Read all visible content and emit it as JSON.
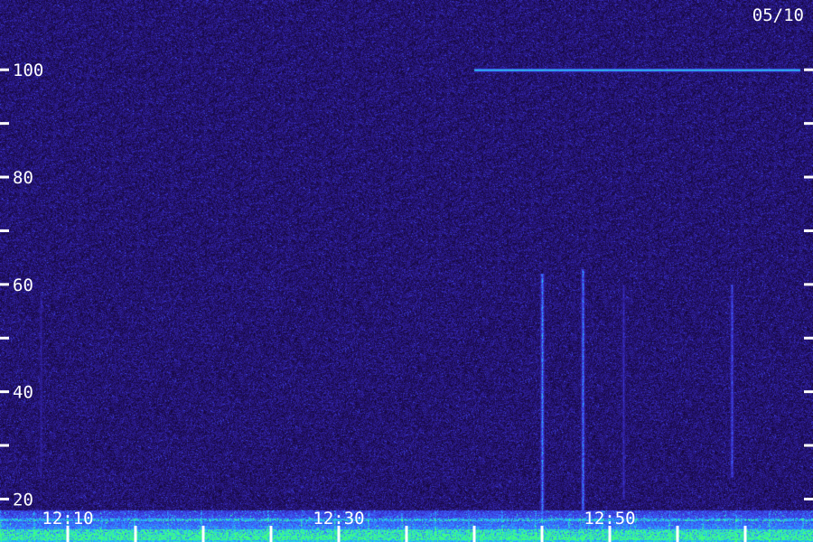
{
  "chart_data": {
    "type": "heatmap",
    "title": "",
    "date_label": "05/10",
    "xlabel": "",
    "ylabel": "",
    "y_axis": {
      "range": [
        12,
        113
      ],
      "tick_labels": [
        "20",
        "40",
        "60",
        "80",
        "100"
      ],
      "major_ticks": [
        20,
        40,
        60,
        80,
        100
      ],
      "minor_ticks": [
        30,
        50,
        70,
        90
      ]
    },
    "x_axis": {
      "range": [
        "12:05",
        "13:05"
      ],
      "tick_labels": [
        "12:10",
        "12:30",
        "12:50"
      ],
      "labeled_ticks": [
        "12:10",
        "12:30",
        "12:50"
      ]
    },
    "colormap": [
      "#000000",
      "#1a0a4a",
      "#2a1a8a",
      "#3a30d0",
      "#3a6aff",
      "#20c0ff",
      "#40ff80"
    ],
    "features": [
      {
        "kind": "horizontal-line",
        "y": 100,
        "x_start": "12:40",
        "x_end": "13:04",
        "intensity": 0.85
      },
      {
        "kind": "vertical-burst",
        "x": "12:08",
        "y_range": [
          24,
          58
        ],
        "intensity": 0.45
      },
      {
        "kind": "vertical-burst",
        "x": "12:45",
        "y_range": [
          14,
          62
        ],
        "intensity": 0.9
      },
      {
        "kind": "vertical-burst",
        "x": "12:48",
        "y_range": [
          18,
          63
        ],
        "intensity": 0.85
      },
      {
        "kind": "vertical-burst",
        "x": "12:51",
        "y_range": [
          20,
          60
        ],
        "intensity": 0.55
      },
      {
        "kind": "vertical-burst",
        "x": "12:59",
        "y_range": [
          24,
          60
        ],
        "intensity": 0.7
      },
      {
        "kind": "low-band-noise",
        "y_range": [
          12,
          18
        ],
        "intensity": 0.9
      }
    ]
  }
}
